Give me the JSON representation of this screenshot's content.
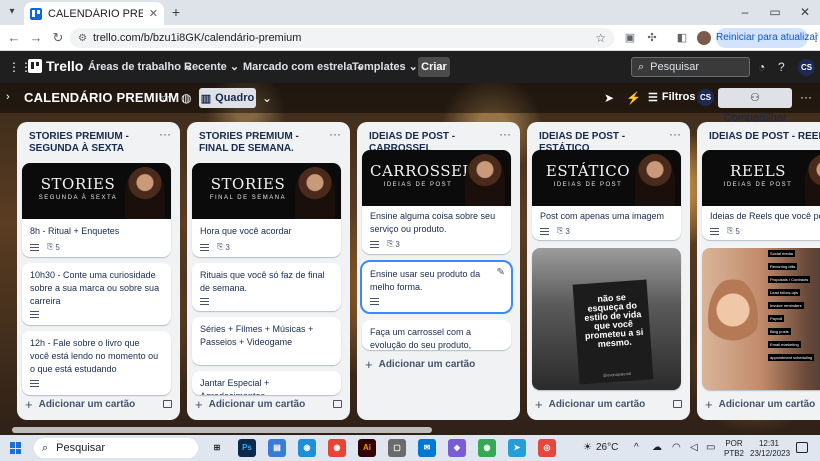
{
  "browser": {
    "tab_title": "CALENDÁRIO PREMIUM | Trello",
    "url": "trello.com/b/bzu1i8GK/calendário-premium",
    "update_label": "Reiniciar para atualizar"
  },
  "trello_header": {
    "logo": "Trello",
    "menus": [
      "Áreas de trabalho",
      "Recente",
      "Marcado com estrela",
      "Templates"
    ],
    "create_label": "Criar",
    "search_placeholder": "Pesquisar",
    "avatar": "CS"
  },
  "board": {
    "title": "CALENDÁRIO PREMIUM",
    "view_label": "Quadro",
    "filters_label": "Filtros",
    "avatar": "CS",
    "share_label": "Compartilhar"
  },
  "lists": [
    {
      "title": "STORIES PREMIUM - SEGUNDA À SEXTA",
      "cover": {
        "big": "STORIES",
        "small": "SEGUNDA À SEXTA"
      },
      "cards": [
        {
          "text": "8h - Ritual + Enquetes",
          "attachments": "5"
        },
        {
          "text": "10h30 - Conte uma curiosidade sobre a sua marca ou sobre sua carreira"
        },
        {
          "text": "12h - Fale sobre o livro que você está lendo no momento ou o que está estudando"
        }
      ],
      "add_label": "Adicionar um cartão"
    },
    {
      "title": "STORIES PREMIUM - FINAL DE SEMANA.",
      "cover": {
        "big": "STORIES",
        "small": "FINAL DE SEMANA"
      },
      "cards": [
        {
          "text": "Hora que você acordar",
          "attachments": "3"
        },
        {
          "text": "Rituais que você só faz de final de semana."
        },
        {
          "text": "Séries + Filmes + Músicas + Passeios + Videogame"
        },
        {
          "text": "Jantar Especial + Agradecimentos"
        }
      ],
      "add_label": "Adicionar um cartão"
    },
    {
      "title": "IDEIAS DE POST - CARROSSEL",
      "cover": {
        "big": "CARROSSEL",
        "small": "IDEIAS DE POST"
      },
      "cards": [
        {
          "text": "Ensine alguma coisa sobre seu serviço ou produto.",
          "attachments": "3"
        },
        {
          "text": "Ensine usar seu produto da melho forma."
        },
        {
          "text": "Faça um carrossel com a evolução do seu produto, serviço e entrega."
        }
      ],
      "add_label": "Adicionar um cartão"
    },
    {
      "title": "IDEIAS DE POST - ESTÁTICO",
      "cover": {
        "big": "ESTÁTICO",
        "small": "IDEIAS DE POST"
      },
      "cards": [
        {
          "text": "Post com apenas uma imagem",
          "attachments": "3"
        }
      ],
      "image_card": {
        "sign_text": "não se esqueça do estilo de vida que você prometeu a si mesmo.",
        "credit": "@ovonapaterial"
      },
      "add_label": "Adicionar um cartão"
    },
    {
      "title": "IDEIAS DE POST - REELS",
      "cover": {
        "big": "REELS",
        "small": "IDEIAS DE POST"
      },
      "cards": [
        {
          "text": "Ideias de Reels que você pode",
          "attachments": "5"
        }
      ],
      "image_card": {
        "tags": [
          "Social media",
          "Recurring bills",
          "Proposals / Contracts",
          "Lead follow-ups",
          "Invoice reminders",
          "Payroll",
          "Blog posts",
          "Email marketing",
          "appointment scheduling"
        ]
      },
      "add_label": "Adicionar um cartão"
    }
  ],
  "taskbar": {
    "search": "Pesquisar",
    "temp": "26°C",
    "lang": [
      "POR",
      "PTB2"
    ],
    "time": "12:31",
    "date": "23/12/2023",
    "apps": [
      "Ps",
      "Ai"
    ]
  }
}
